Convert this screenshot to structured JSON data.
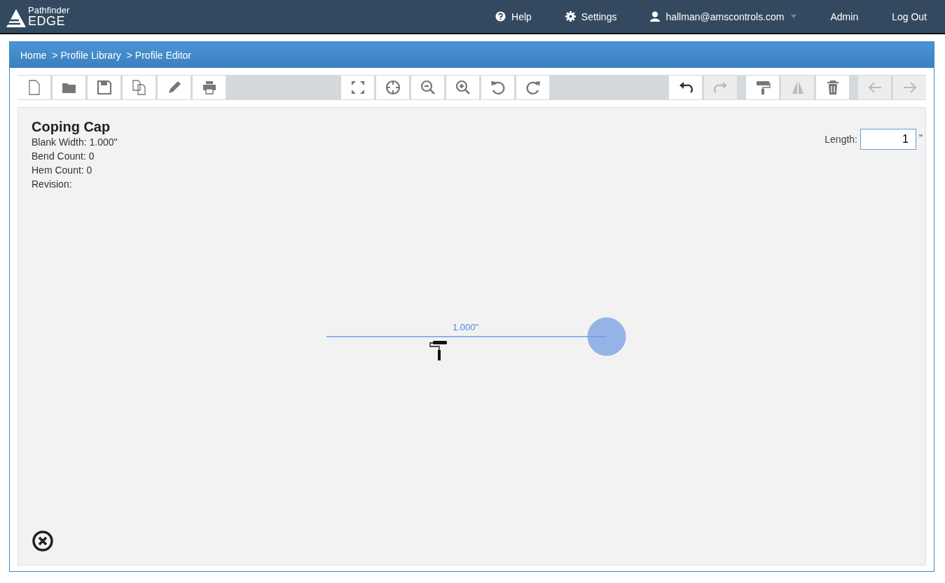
{
  "brand": {
    "top": "Pathfinder",
    "bottom": "EDGE"
  },
  "nav": [
    {
      "kind": "help",
      "label": "Help"
    },
    {
      "kind": "settings",
      "label": "Settings"
    },
    {
      "kind": "user",
      "label": "hallman@amscontrols.com",
      "dropdown": true
    },
    {
      "kind": "plain",
      "label": "Admin"
    },
    {
      "kind": "plain",
      "label": "Log Out"
    }
  ],
  "breadcrumb": [
    "Home",
    "> Profile Library",
    "> Profile Editor"
  ],
  "toolbar_groups": [
    [
      {
        "kind": "new",
        "disabled": false
      },
      {
        "kind": "open",
        "disabled": false
      },
      {
        "kind": "save",
        "disabled": false
      },
      {
        "kind": "copy",
        "disabled": false
      },
      {
        "kind": "edit",
        "disabled": false
      },
      {
        "kind": "print",
        "disabled": false
      }
    ],
    [
      {
        "kind": "fit",
        "disabled": false
      },
      {
        "kind": "center",
        "disabled": false
      },
      {
        "kind": "zoom-out",
        "disabled": false
      },
      {
        "kind": "zoom-in",
        "disabled": false
      },
      {
        "kind": "rotate-left",
        "disabled": false
      },
      {
        "kind": "rotate-right",
        "disabled": false
      }
    ],
    [
      {
        "kind": "undo",
        "disabled": false
      },
      {
        "kind": "redo",
        "disabled": true
      }
    ],
    [
      {
        "kind": "paint",
        "disabled": false
      },
      {
        "kind": "mirror",
        "disabled": true
      },
      {
        "kind": "delete",
        "disabled": false
      }
    ],
    [
      {
        "kind": "back",
        "disabled": true
      },
      {
        "kind": "forward",
        "disabled": true
      }
    ]
  ],
  "profile": {
    "title": "Coping Cap",
    "details": [
      "Blank Width: 1.000\"",
      "Bend Count: 0",
      "Hem Count: 0",
      "Revision:"
    ]
  },
  "length": {
    "label": "Length:",
    "value": "1",
    "unit": "\""
  },
  "drawing": {
    "dimension": "1.000\""
  }
}
